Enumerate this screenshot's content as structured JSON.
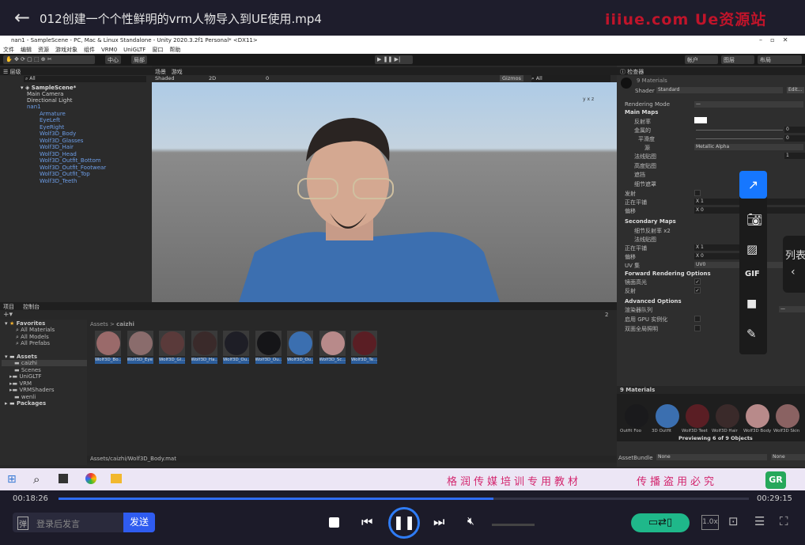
{
  "player": {
    "title": "012创建一个个性鲜明的vrm人物导入到UE使用.mp4",
    "watermark": "iiiue.com Ue资源站",
    "current_time": "00:18:26",
    "total_time": "00:29:15",
    "progress_percent": 63,
    "danmaku_placeholder": "登录后发言",
    "danmaku_icon": "弹",
    "send_label": "发送",
    "speed": "1.0x",
    "list_label": "列表",
    "accent": "#2f6cf5"
  },
  "taskbar": {
    "notice_left": "格润传媒培训专用教材",
    "notice_right": "传播盗用必究",
    "logo": "GR"
  },
  "unity": {
    "title": "nan1 - SampleScene - PC, Mac & Linux Standalone - Unity 2020.3.2f1 Personal* <DX11>",
    "menu": [
      "文件",
      "编辑",
      "资源",
      "游戏对象",
      "组件",
      "VRM0",
      "UniGLTF",
      "窗口",
      "帮助"
    ],
    "toolbar": {
      "center": "中心",
      "local": "局部",
      "account": "帐户",
      "layers": "图层",
      "layout": "布局"
    },
    "hierarchy": {
      "tab": "层级",
      "search": "All",
      "scene": "SampleScene*",
      "items": [
        "Main Camera",
        "Directional Light",
        "nan1",
        "Armature",
        "EyeLeft",
        "EyeRight",
        "Wolf3D_Body",
        "Wolf3D_Glasses",
        "Wolf3D_Hair",
        "Wolf3D_Head",
        "Wolf3D_Outfit_Bottom",
        "Wolf3D_Outfit_Footwear",
        "Wolf3D_Outfit_Top",
        "Wolf3D_Teeth"
      ]
    },
    "scene": {
      "tab_scene": "场景",
      "tab_game": "游戏",
      "shading": "Shaded",
      "mode2d": "2D",
      "fx_count": "0",
      "gizmos": "Gizmos",
      "search": "All",
      "axis_labels": [
        "x",
        "y",
        "z"
      ]
    },
    "inspector": {
      "tab": "检查器",
      "object": "9 Materials",
      "shader_label": "Shader",
      "shader": "Standard",
      "edit": "Edit...",
      "rendering_mode": "Rendering Mode",
      "rendering_mode_value": "—",
      "main_maps": "Main Maps",
      "rows": [
        "反射率",
        "金属的",
        "平滑度",
        "源",
        "法线贴图",
        "高度贴图",
        "遮挡",
        "细节遮罩",
        "发射",
        "正在平铺",
        "偏移"
      ],
      "metallic": "0",
      "smoothness": "0",
      "source": "Metallic Alpha",
      "normal_scale": "1",
      "tiling_x": "1",
      "tiling_y": "1",
      "offset_x": "0",
      "offset_y": "0",
      "secondary_maps": "Secondary Maps",
      "sec_rows": [
        "细节反射率 x2",
        "法线贴图",
        "正在平铺",
        "偏移",
        "UV 集"
      ],
      "sec_tiling_x": "1",
      "sec_offset_x": "0",
      "uv_set": "UV0",
      "forward": "Forward Rendering Options",
      "fwd_rows": [
        "镜面高光",
        "反射"
      ],
      "advanced": "Advanced Options",
      "adv_rows": [
        "渲染器队列",
        "启用 GPU 实例化",
        "双面全局照明"
      ],
      "queue": "—",
      "preview_title": "9 Materials",
      "preview_labels": [
        "Outfit Foo",
        "3D Outfit",
        "Wolf3D Teet",
        "Wolf3D Hair",
        "Wolf3D Body",
        "Wolf3D Skin"
      ],
      "previewing": "Previewing 6 of 9 Objects",
      "assetbundle": "AssetBundle",
      "ab_none1": "None",
      "ab_none2": "None"
    },
    "project": {
      "tab_project": "项目",
      "tab_console": "控制台",
      "favorites": "Favorites",
      "fav_items": [
        "All Materials",
        "All Models",
        "All Prefabs"
      ],
      "assets": "Assets",
      "folders": [
        "caizhi",
        "Scenes",
        "UniGLTF",
        "VRM",
        "VRMShaders",
        "wenli"
      ],
      "packages": "Packages",
      "breadcrumb": [
        "Assets",
        "caizhi"
      ],
      "count": "2",
      "materials": [
        "Wolf3D_Bo...",
        "Wolf3D_Eye",
        "Wolf3D_Gl...",
        "Wolf3D_Ha...",
        "Wolf3D_Ou...",
        "Wolf3D_Ou...",
        "Wolf3D_Ou...",
        "Wolf3D_Sc...",
        "Wolf3D_Te..."
      ],
      "material_colors": [
        "#9a6a6a",
        "#8a6c6c",
        "#5a3a3a",
        "#3a2a2a",
        "#1e1e26",
        "#151518",
        "#3b6fb0",
        "#b88a8a",
        "#5a1e24"
      ],
      "status_path": "Assets/caizhi/Wolf3D_Body.mat"
    }
  }
}
